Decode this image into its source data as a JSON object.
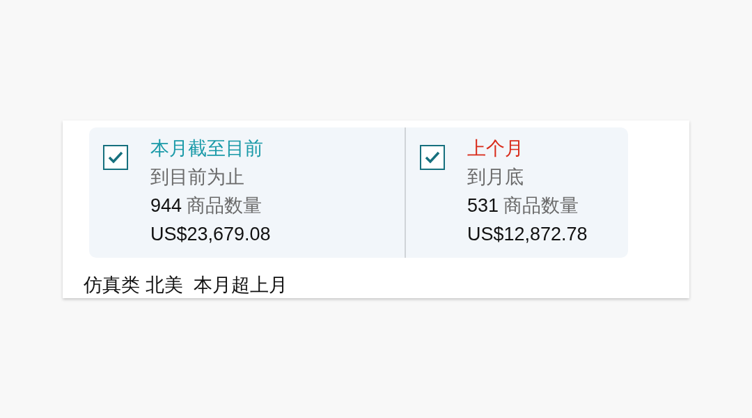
{
  "periods": [
    {
      "checked": true,
      "title": "本月截至目前",
      "color": "#1a9aa8",
      "range": "到目前为止",
      "count": "944",
      "count_label": "商品数量",
      "amount": "US$23,679.08"
    },
    {
      "checked": true,
      "title": "上个月",
      "color": "#d92b1a",
      "range": "到月底",
      "count": "531",
      "count_label": "商品数量",
      "amount": "US$12,872.78"
    }
  ],
  "caption": "仿真类 北美  本月超上月"
}
